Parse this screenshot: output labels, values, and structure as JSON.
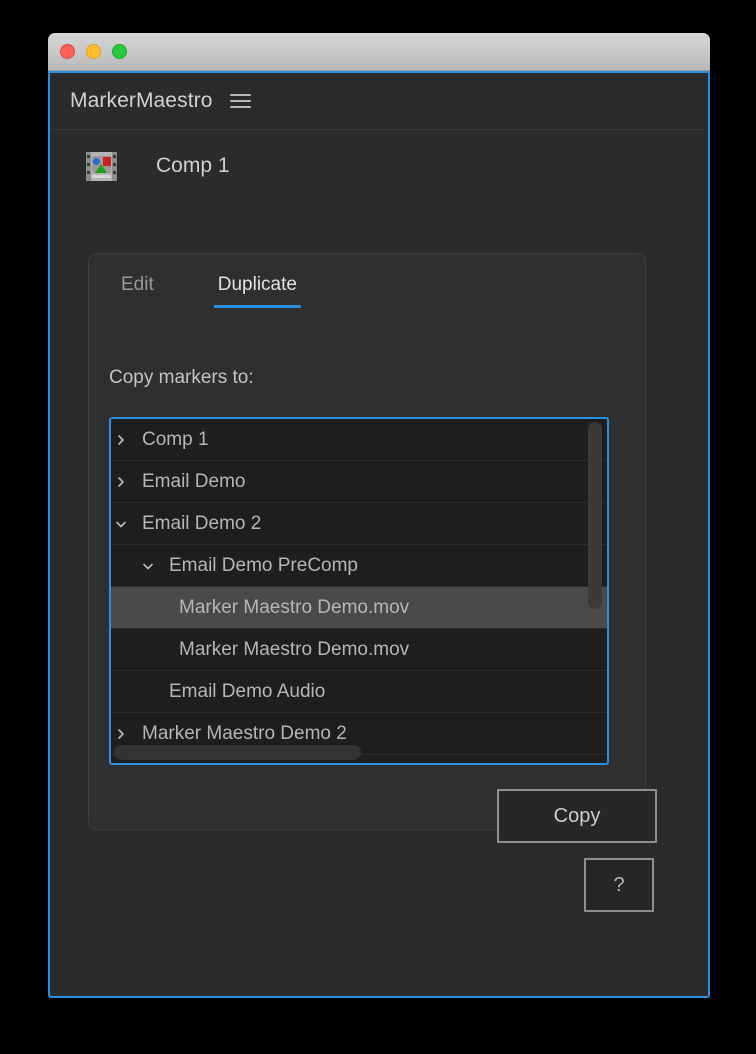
{
  "window": {
    "traffic_lights": [
      {
        "name": "close",
        "color": "#ff5f57"
      },
      {
        "name": "minimize",
        "color": "#ffbd2e"
      },
      {
        "name": "zoom",
        "color": "#28c840"
      }
    ],
    "focus_border_color": "#2a8fe0"
  },
  "header": {
    "app_title": "MarkerMaestro",
    "menu_icon": "hamburger-menu-icon"
  },
  "comp": {
    "icon": "composition-icon",
    "name": "Comp 1"
  },
  "tabs": [
    {
      "label": "Edit",
      "active": false
    },
    {
      "label": "Duplicate",
      "active": true
    }
  ],
  "panel": {
    "copy_label": "Copy markers to:",
    "accent_color": "#2a8fe0"
  },
  "tree": {
    "rows": [
      {
        "label": "Comp 1",
        "level": 0,
        "chevron": "chevron-right-icon",
        "expanded": false,
        "selected": false
      },
      {
        "label": "Email Demo",
        "level": 0,
        "chevron": "chevron-right-icon",
        "expanded": false,
        "selected": false
      },
      {
        "label": "Email Demo 2",
        "level": 0,
        "chevron": "chevron-down-icon",
        "expanded": true,
        "selected": false
      },
      {
        "label": "Email Demo PreComp",
        "level": 1,
        "chevron": "chevron-down-icon",
        "expanded": true,
        "selected": false
      },
      {
        "label": "Marker Maestro Demo.mov",
        "level": 2,
        "chevron": "",
        "expanded": false,
        "selected": true
      },
      {
        "label": "Marker Maestro Demo.mov",
        "level": 2,
        "chevron": "",
        "expanded": false,
        "selected": false
      },
      {
        "label": "Email Demo Audio",
        "level": 1,
        "chevron": "",
        "expanded": false,
        "selected": false
      },
      {
        "label": "Marker Maestro Demo 2",
        "level": 0,
        "chevron": "chevron-right-icon",
        "expanded": false,
        "selected": false
      }
    ],
    "vertical_scrollbar": "vertical-scrollbar",
    "horizontal_scrollbar": "horizontal-scrollbar",
    "selected_row_color": "#4a4a4a"
  },
  "actions": {
    "copy_label": "Copy",
    "help_label": "?"
  }
}
